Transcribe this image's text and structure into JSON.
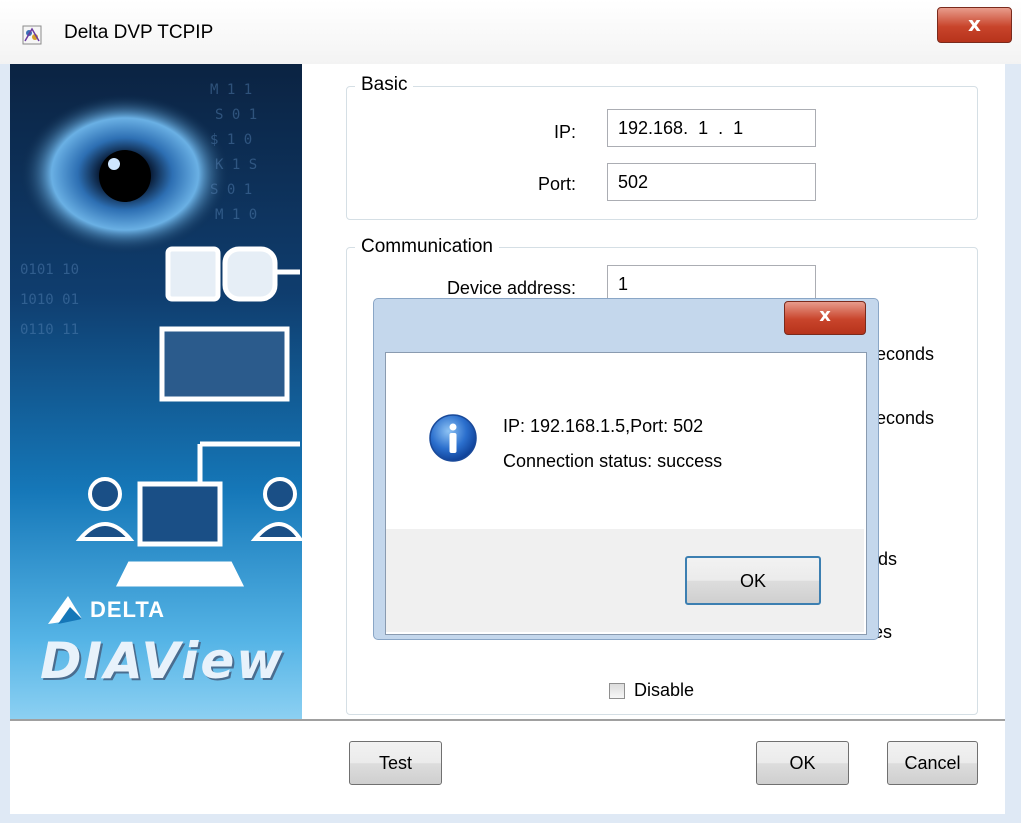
{
  "window": {
    "title": "Delta DVP TCPIP",
    "close_label": "x"
  },
  "banner": {
    "brand": "DELTA",
    "product": "DIAView"
  },
  "basic": {
    "legend": "Basic",
    "ip_label": "IP:",
    "ip_value": "192.168.  1  .  1",
    "port_label": "Port:",
    "port_value": "502"
  },
  "communication": {
    "legend": "Communication",
    "device_address_label": "Device address:",
    "device_address_value": "1",
    "unit_seconds_1": "econds",
    "unit_seconds_2": "econds",
    "unit_seconds_3": "nds",
    "unit_minutes": "tes",
    "disable_label": "Disable",
    "disable_checked": false
  },
  "footer": {
    "test_label": "Test",
    "ok_label": "OK",
    "cancel_label": "Cancel"
  },
  "message_box": {
    "close_label": "x",
    "line1": "IP: 192.168.1.5,Port: 502",
    "line2": "Connection status: success",
    "ok_label": "OK",
    "icon": "info-icon"
  }
}
